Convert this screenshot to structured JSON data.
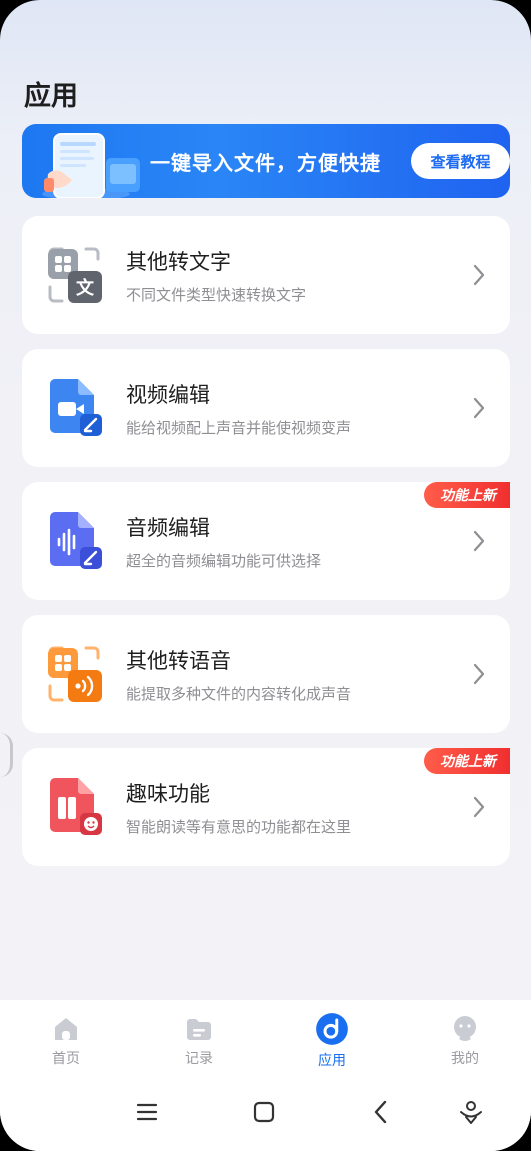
{
  "header": {
    "title": "应用"
  },
  "banner": {
    "text": "一键导入文件，方便快捷",
    "button_label": "查看教程",
    "accent": "#1d78f1"
  },
  "cards": [
    {
      "title": "其他转文字",
      "subtitle": "不同文件类型快速转换文字",
      "icon": "file-to-text-icon",
      "badge": ""
    },
    {
      "title": "视频编辑",
      "subtitle": "能给视频配上声音并能使视频变声",
      "icon": "video-edit-icon",
      "badge": ""
    },
    {
      "title": "音频编辑",
      "subtitle": "超全的音频编辑功能可供选择",
      "icon": "audio-edit-icon",
      "badge": "功能上新"
    },
    {
      "title": "其他转语音",
      "subtitle": "能提取多种文件的内容转化成声音",
      "icon": "file-to-speech-icon",
      "badge": ""
    },
    {
      "title": "趣味功能",
      "subtitle": "智能朗读等有意思的功能都在这里",
      "icon": "fun-feature-icon",
      "badge": "功能上新"
    }
  ],
  "tabs": [
    {
      "label": "首页",
      "icon": "home-icon",
      "active": false
    },
    {
      "label": "记录",
      "icon": "folder-icon",
      "active": false
    },
    {
      "label": "应用",
      "icon": "apps-icon",
      "active": true
    },
    {
      "label": "我的",
      "icon": "profile-icon",
      "active": false
    }
  ],
  "colors": {
    "active_tab": "#1a6ff0",
    "inactive_tab": "#9a9aa0",
    "badge": "#f02f2f"
  }
}
